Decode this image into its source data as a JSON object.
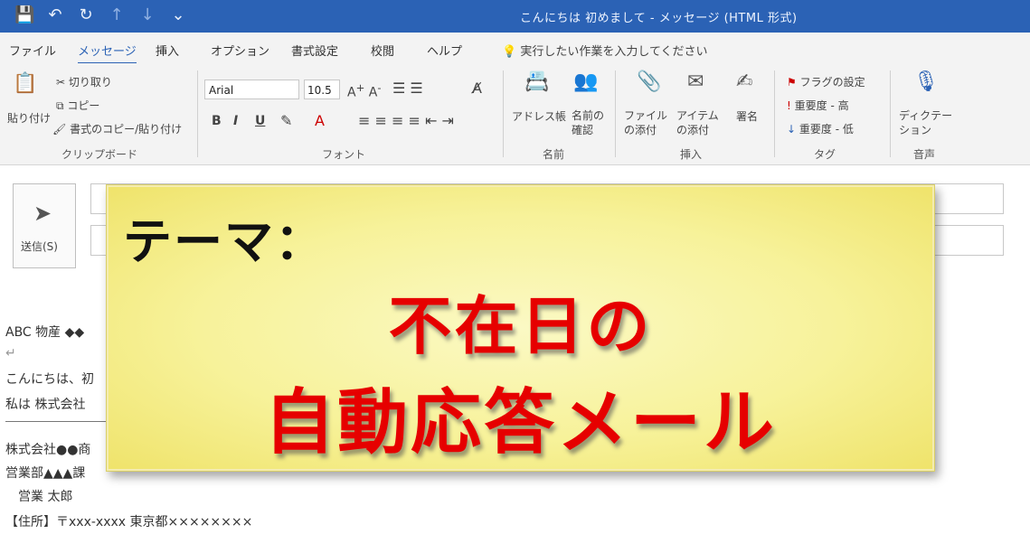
{
  "titlebar": {
    "window_title": "こんにちは 初めまして - メッセージ (HTML 形式)",
    "qat": {
      "save": "💾",
      "undo": "↶",
      "redo": "↻",
      "up": "↑",
      "down": "↓",
      "more": "⌄"
    }
  },
  "tabs": [
    {
      "label": "ファイル"
    },
    {
      "label": "メッセージ"
    },
    {
      "label": "挿入"
    },
    {
      "label": "オプション"
    },
    {
      "label": "書式設定"
    },
    {
      "label": "校閲"
    },
    {
      "label": "ヘルプ"
    }
  ],
  "tell_me": "実行したい作業を入力してください",
  "ribbon": {
    "clipboard": {
      "paste": "貼り付け",
      "cut": "切り取り",
      "copy": "コピー",
      "format_painter": "書式のコピー/貼り付け",
      "group": "クリップボード"
    },
    "font": {
      "font_name": "Arial",
      "font_size": "10.5",
      "bold": "B",
      "italic": "I",
      "underline": "U",
      "group": "フォント"
    },
    "names": {
      "address_book": "アドレス帳",
      "check_names": "名前の確認",
      "group": "名前"
    },
    "include": {
      "attach_file": "ファイルの添付",
      "attach_item": "アイテムの添付",
      "signature": "署名",
      "group": "挿入"
    },
    "tags": {
      "follow_up": "フラグの設定",
      "high_importance": "重要度 - 高",
      "low_importance": "重要度 - 低",
      "group": "タグ"
    },
    "voice": {
      "dictate": "ディクテーション",
      "group": "音声"
    }
  },
  "compose": {
    "send_label": "送信(S)",
    "body_lines": [
      "ABC 物産 ◆◆",
      "↵",
      "こんにちは、初",
      "私は 株式会社",
      "株式会社●●商",
      "営業部▲▲▲課",
      "営業 太郎",
      "【住所】〒xxx-xxxx 東京都××××××××"
    ]
  },
  "overlay": {
    "theme_label": "テーマ：",
    "headline_line1": "不在日の",
    "headline_line2": "自動応答メール"
  }
}
